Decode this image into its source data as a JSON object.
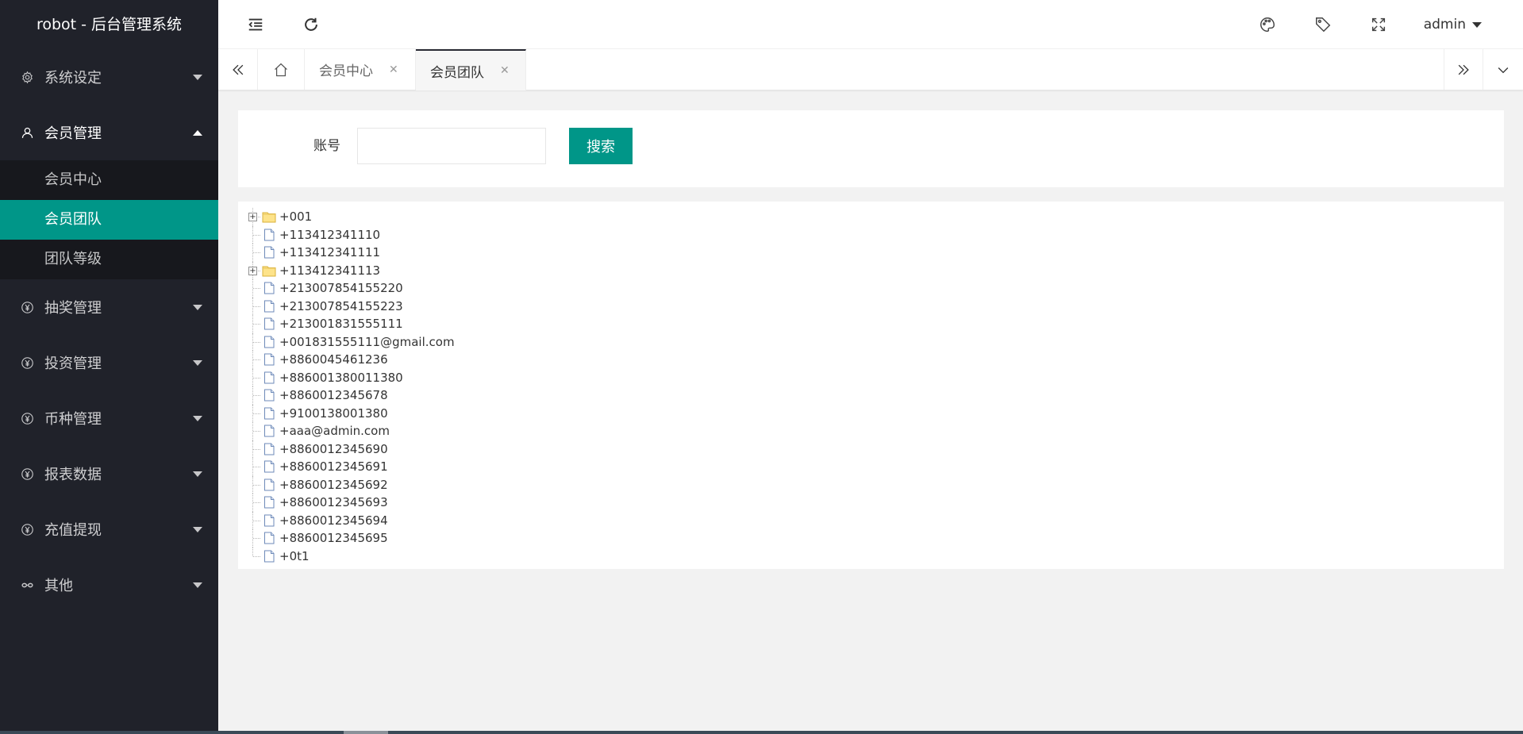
{
  "app": {
    "title": "robot - 后台管理系统"
  },
  "sidebar": {
    "items": [
      {
        "label": "系统设定",
        "icon": "gear-icon"
      },
      {
        "label": "会员管理",
        "icon": "user-icon",
        "open": true,
        "children": [
          {
            "label": "会员中心"
          },
          {
            "label": "会员团队",
            "active": true
          },
          {
            "label": "团队等级"
          }
        ]
      },
      {
        "label": "抽奖管理",
        "icon": "yen-icon"
      },
      {
        "label": "投资管理",
        "icon": "yen-icon"
      },
      {
        "label": "币种管理",
        "icon": "yen-icon"
      },
      {
        "label": "报表数据",
        "icon": "yen-icon"
      },
      {
        "label": "充值提现",
        "icon": "yen-icon"
      },
      {
        "label": "其他",
        "icon": "link-icon"
      }
    ]
  },
  "header": {
    "user": "admin"
  },
  "tabs": [
    {
      "label": "会员中心",
      "closable": true
    },
    {
      "label": "会员团队",
      "closable": true,
      "active": true
    }
  ],
  "search": {
    "label": "账号",
    "value": "",
    "placeholder": "",
    "button": "搜索"
  },
  "tree": [
    {
      "label": "+001",
      "type": "folder",
      "expander": "+"
    },
    {
      "label": "+113412341110",
      "type": "file"
    },
    {
      "label": "+113412341111",
      "type": "file"
    },
    {
      "label": "+113412341113",
      "type": "folder",
      "expander": "+"
    },
    {
      "label": "+213007854155220",
      "type": "file"
    },
    {
      "label": "+213007854155223",
      "type": "file"
    },
    {
      "label": "+213001831555111",
      "type": "file"
    },
    {
      "label": "+001831555111@gmail.com",
      "type": "file"
    },
    {
      "label": "+8860045461236",
      "type": "file"
    },
    {
      "label": "+886001380011380",
      "type": "file"
    },
    {
      "label": "+8860012345678",
      "type": "file"
    },
    {
      "label": "+9100138001380",
      "type": "file"
    },
    {
      "label": "+aaa@admin.com",
      "type": "file"
    },
    {
      "label": "+8860012345690",
      "type": "file"
    },
    {
      "label": "+8860012345691",
      "type": "file"
    },
    {
      "label": "+8860012345692",
      "type": "file"
    },
    {
      "label": "+8860012345693",
      "type": "file"
    },
    {
      "label": "+8860012345694",
      "type": "file"
    },
    {
      "label": "+8860012345695",
      "type": "file"
    },
    {
      "label": "+0t1",
      "type": "file"
    }
  ]
}
